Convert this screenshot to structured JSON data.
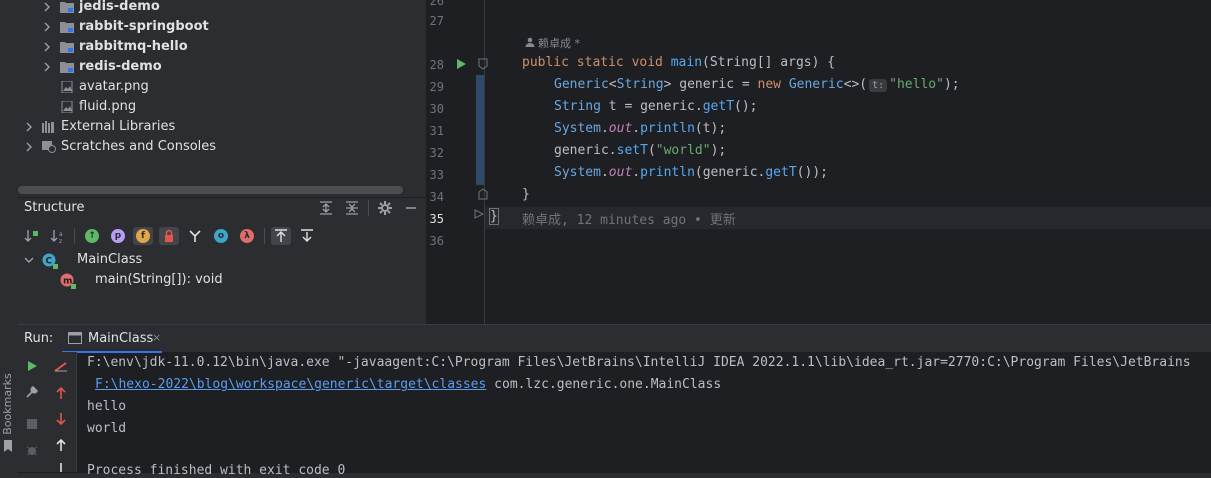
{
  "sidebar": {
    "bookmarks_label": "Bookmarks"
  },
  "project_tree": {
    "items": [
      {
        "label": "jedis-demo",
        "type": "module",
        "bold": true
      },
      {
        "label": "rabbit-springboot",
        "type": "module",
        "bold": true
      },
      {
        "label": "rabbitmq-hello",
        "type": "module",
        "bold": true
      },
      {
        "label": "redis-demo",
        "type": "module",
        "bold": true
      },
      {
        "label": "avatar.png",
        "type": "image-file"
      },
      {
        "label": "fluid.png",
        "type": "image-file"
      },
      {
        "label": "External Libraries",
        "type": "libraries"
      },
      {
        "label": "Scratches and Consoles",
        "type": "scratches"
      }
    ]
  },
  "structure": {
    "title": "Structure",
    "root": "MainClass",
    "child": "main(String[]): void"
  },
  "editor": {
    "author_hint": "赖卓成 *",
    "line_numbers": [
      "27",
      "28",
      "29",
      "30",
      "31",
      "32",
      "33",
      "34",
      "35",
      "36"
    ],
    "line_numbers_top_partial": "26",
    "code": {
      "l28": {
        "kw1": "public static void ",
        "fn": "main",
        "rest": "(String[] args) {"
      },
      "l29": {
        "ty1": "Generic",
        "p1": "<",
        "ty2": "String",
        "p2": "> generic = ",
        "kw": "new ",
        "ty3": "Generic",
        "p3": "<>(",
        "hint": "t:",
        "st": "\"hello\"",
        "p4": ");"
      },
      "l30": {
        "ty": "String",
        "p1": " t = generic.",
        "fn": "getT",
        "p2": "();"
      },
      "l31": {
        "ty": "System",
        "p1": ".",
        "it": "out",
        "p2": ".",
        "fn": "println",
        "p3": "(t);"
      },
      "l32": {
        "p1": "generic.",
        "fn": "setT",
        "p2": "(",
        "st": "\"world\"",
        "p3": ");"
      },
      "l33": {
        "ty": "System",
        "p1": ".",
        "it": "out",
        "p2": ".",
        "fn": "println",
        "p3": "(generic.",
        "fn2": "getT",
        "p4": "());"
      },
      "l34": "}",
      "l35": "}"
    },
    "inline_blame": "赖卓成, 12 minutes ago • 更新"
  },
  "run": {
    "label": "Run:",
    "tab": "MainClass",
    "close": "×",
    "output": {
      "cmd": "F:\\env\\jdk-11.0.12\\bin\\java.exe \"-javaagent:C:\\Program Files\\JetBrains\\IntelliJ IDEA 2022.1.1\\lib\\idea_rt.jar=2770:C:\\Program Files\\JetBrains",
      "classpath_link": "F:\\hexo-2022\\blog\\workspace\\generic\\target\\classes",
      "classpath_rest": " com.lzc.generic.one.MainClass",
      "line1": "hello",
      "line2": "world",
      "line3": "Process finished with exit code 0"
    }
  },
  "colors": {
    "accent": "#3574f0",
    "run_green": "#5fb865",
    "stop_red": "#e0564b"
  }
}
